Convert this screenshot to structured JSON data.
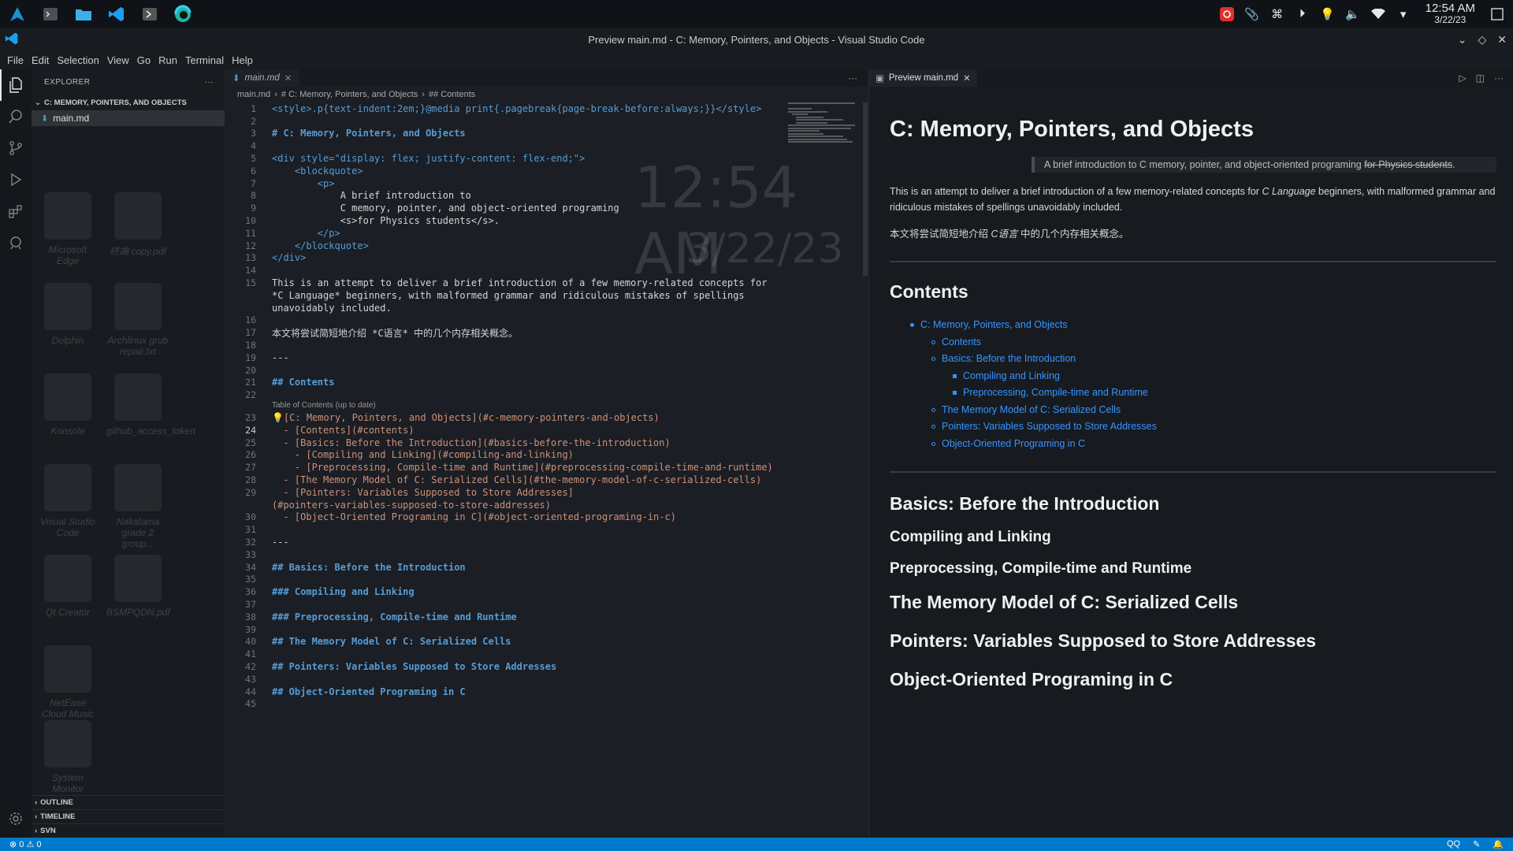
{
  "taskbar": {
    "apps": [
      "app-launcher",
      "terminal",
      "file-manager",
      "vscode",
      "console",
      "edge"
    ],
    "clock": {
      "time": "12:54 AM",
      "date": "3/22/23"
    }
  },
  "window": {
    "title": "Preview main.md - C: Memory, Pointers, and Objects - Visual Studio Code"
  },
  "menu": [
    "File",
    "Edit",
    "Selection",
    "View",
    "Go",
    "Run",
    "Terminal",
    "Help"
  ],
  "sidebar": {
    "title": "EXPLORER",
    "folder": "C: MEMORY, POINTERS, AND OBJECTS",
    "file": "main.md",
    "footer": [
      "OUTLINE",
      "TIMELINE",
      "SVN"
    ]
  },
  "desktop_icons": [
    {
      "label": "Microsoft Edge"
    },
    {
      "label": "终端 copy.pdf"
    },
    {
      "label": "Dolphin"
    },
    {
      "label": "Archlinux grub repair.txt"
    },
    {
      "label": "Konsole"
    },
    {
      "label": "github_access_token"
    },
    {
      "label": "Visual Studio Code"
    },
    {
      "label": "Nakatama grade 2 group..."
    },
    {
      "label": "Qt Creator"
    },
    {
      "label": "BSMPQDN.pdf"
    },
    {
      "label": "NetEase Cloud Music"
    },
    {
      "label": "System Monitor"
    }
  ],
  "editor": {
    "tab": "main.md",
    "breadcrumb": [
      "main.md",
      "# C: Memory, Pointers, and Objects",
      "## Contents"
    ],
    "codelens": "Table of Contents (up to date)",
    "lines": [
      {
        "n": "1",
        "t": "<style>.p{text-indent:2em;}@media print{.pagebreak{page-break-before:always;}}</style>",
        "k": "tag"
      },
      {
        "n": "2",
        "t": "",
        "k": ""
      },
      {
        "n": "3",
        "t": "# C: Memory, Pointers, and Objects",
        "k": "head"
      },
      {
        "n": "4",
        "t": "",
        "k": ""
      },
      {
        "n": "5",
        "t": "<div style=\"display: flex; justify-content: flex-end;\">",
        "k": "tag"
      },
      {
        "n": "6",
        "t": "    <blockquote>",
        "k": "tag"
      },
      {
        "n": "7",
        "t": "        <p>",
        "k": "tag"
      },
      {
        "n": "8",
        "t": "            A brief introduction to",
        "k": ""
      },
      {
        "n": "9",
        "t": "            C memory, pointer, and object-oriented programing",
        "k": ""
      },
      {
        "n": "10",
        "t": "            <s>for Physics students</s>.",
        "k": ""
      },
      {
        "n": "11",
        "t": "        </p>",
        "k": "tag"
      },
      {
        "n": "12",
        "t": "    </blockquote>",
        "k": "tag"
      },
      {
        "n": "13",
        "t": "</div>",
        "k": "tag"
      },
      {
        "n": "14",
        "t": "",
        "k": ""
      },
      {
        "n": "15",
        "t": "This is an attempt to deliver a brief introduction of a few memory-related concepts for",
        "k": ""
      },
      {
        "n": "",
        "t": "*C Language* beginners, with malformed grammar and ridiculous mistakes of spellings",
        "k": ""
      },
      {
        "n": "",
        "t": "unavoidably included.",
        "k": ""
      },
      {
        "n": "16",
        "t": "",
        "k": ""
      },
      {
        "n": "17",
        "t": "本文将尝试简短地介绍 *C语言* 中的几个内存相关概念。",
        "k": ""
      },
      {
        "n": "18",
        "t": "",
        "k": ""
      },
      {
        "n": "19",
        "t": "---",
        "k": ""
      },
      {
        "n": "20",
        "t": "",
        "k": ""
      },
      {
        "n": "21",
        "t": "## Contents",
        "k": "head"
      },
      {
        "n": "22",
        "t": "",
        "k": ""
      },
      {
        "n": "23",
        "t": "💡[C: Memory, Pointers, and Objects](#c-memory-pointers-and-objects)",
        "k": "link"
      },
      {
        "n": "24",
        "t": "  - [Contents](#contents)",
        "k": "link"
      },
      {
        "n": "25",
        "t": "  - [Basics: Before the Introduction](#basics-before-the-introduction)",
        "k": "link"
      },
      {
        "n": "26",
        "t": "    - [Compiling and Linking](#compiling-and-linking)",
        "k": "link"
      },
      {
        "n": "27",
        "t": "    - [Preprocessing, Compile-time and Runtime](#preprocessing-compile-time-and-runtime)",
        "k": "link"
      },
      {
        "n": "28",
        "t": "  - [The Memory Model of C: Serialized Cells](#the-memory-model-of-c-serialized-cells)",
        "k": "link"
      },
      {
        "n": "29",
        "t": "  - [Pointers: Variables Supposed to Store Addresses]",
        "k": "link"
      },
      {
        "n": "",
        "t": "(#pointers-variables-supposed-to-store-addresses)",
        "k": "link"
      },
      {
        "n": "30",
        "t": "  - [Object-Oriented Programing in C](#object-oriented-programing-in-c)",
        "k": "link"
      },
      {
        "n": "31",
        "t": "",
        "k": ""
      },
      {
        "n": "32",
        "t": "---",
        "k": ""
      },
      {
        "n": "33",
        "t": "",
        "k": ""
      },
      {
        "n": "34",
        "t": "## Basics: Before the Introduction",
        "k": "head"
      },
      {
        "n": "35",
        "t": "",
        "k": ""
      },
      {
        "n": "36",
        "t": "### Compiling and Linking",
        "k": "head"
      },
      {
        "n": "37",
        "t": "",
        "k": ""
      },
      {
        "n": "38",
        "t": "### Preprocessing, Compile-time and Runtime",
        "k": "head"
      },
      {
        "n": "39",
        "t": "",
        "k": ""
      },
      {
        "n": "40",
        "t": "## The Memory Model of C: Serialized Cells",
        "k": "head"
      },
      {
        "n": "41",
        "t": "",
        "k": ""
      },
      {
        "n": "42",
        "t": "## Pointers: Variables Supposed to Store Addresses",
        "k": "head"
      },
      {
        "n": "43",
        "t": "",
        "k": ""
      },
      {
        "n": "44",
        "t": "## Object-Oriented Programing in C",
        "k": "head"
      },
      {
        "n": "45",
        "t": "",
        "k": ""
      }
    ],
    "bg_clock": "12:54 AM",
    "bg_date": "3/22/23"
  },
  "preview": {
    "tab": "Preview main.md",
    "h1": "C: Memory, Pointers, and Objects",
    "quote_text": "A brief introduction to C memory, pointer, and object-oriented programing ",
    "quote_strike": "for Physics students",
    "quote_end": ".",
    "p1_pre": "This is an attempt to deliver a brief introduction of a few memory-related concepts for ",
    "p1_em": "C Language",
    "p1_post": " beginners, with malformed grammar and ridiculous mistakes of spellings unavoidably included.",
    "p2_pre": "本文将尝试简短地介绍 ",
    "p2_em": "C语言",
    "p2_post": " 中的几个内存相关概念。",
    "contents_title": "Contents",
    "toc": [
      {
        "level": 1,
        "text": "C: Memory, Pointers, and Objects"
      },
      {
        "level": 2,
        "text": "Contents"
      },
      {
        "level": 2,
        "text": "Basics: Before the Introduction"
      },
      {
        "level": 3,
        "text": "Compiling and Linking"
      },
      {
        "level": 3,
        "text": "Preprocessing, Compile-time and Runtime"
      },
      {
        "level": 2,
        "text": "The Memory Model of C: Serialized Cells"
      },
      {
        "level": 2,
        "text": "Pointers: Variables Supposed to Store Addresses"
      },
      {
        "level": 2,
        "text": "Object-Oriented Programing in C"
      }
    ],
    "h2_basics": "Basics: Before the Introduction",
    "h3_compiling": "Compiling and Linking",
    "h3_preproc": "Preprocessing, Compile-time and Runtime",
    "h2_memory": "The Memory Model of C: Serialized Cells",
    "h2_pointers": "Pointers: Variables Supposed to Store Addresses",
    "h2_oop": "Object-Oriented Programing in C"
  },
  "statusbar": {
    "problems": "⊗ 0 ⚠ 0",
    "right": [
      "QQ"
    ]
  },
  "colors": {
    "accent": "#007acc",
    "link": "#3794ff",
    "keyword": "#569cd6",
    "string": "#ce9178"
  }
}
